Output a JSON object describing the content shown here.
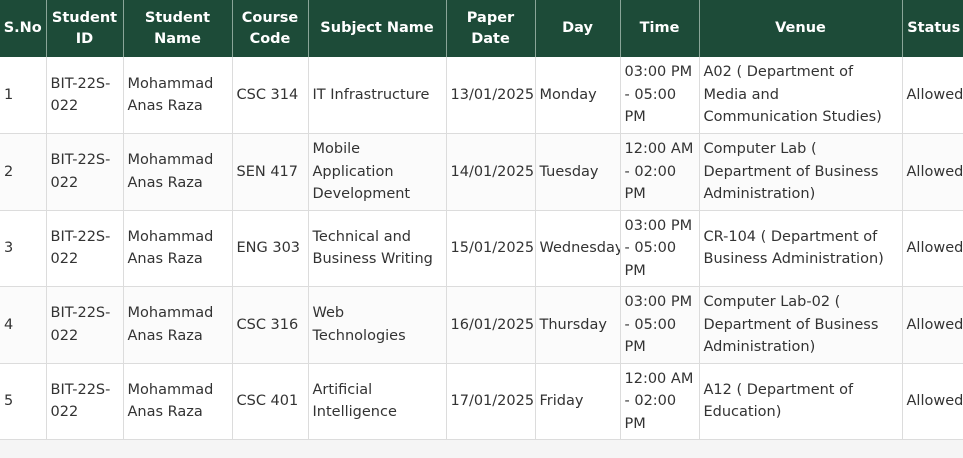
{
  "table": {
    "headers": [
      "S.No",
      "Student ID",
      "Student Name",
      "Course Code",
      "Subject Name",
      "Paper Date",
      "Day",
      "Time",
      "Venue",
      "Status"
    ],
    "rows": [
      {
        "sno": "1",
        "student_id": "BIT-22S-022",
        "student_name": "Mohammad Anas Raza",
        "course_code": "CSC 314",
        "subject_name": "IT Infrastructure",
        "paper_date": "13/01/2025",
        "day": "Monday",
        "time": "03:00 PM - 05:00 PM",
        "venue": "A02 ( Department of Media and Communication Studies)",
        "status": "Allowed"
      },
      {
        "sno": "2",
        "student_id": "BIT-22S-022",
        "student_name": "Mohammad Anas Raza",
        "course_code": "SEN 417",
        "subject_name": "Mobile Application Development",
        "paper_date": "14/01/2025",
        "day": "Tuesday",
        "time": "12:00 AM - 02:00 PM",
        "venue": "Computer Lab ( Department of Business Administration)",
        "status": "Allowed"
      },
      {
        "sno": "3",
        "student_id": "BIT-22S-022",
        "student_name": "Mohammad Anas Raza",
        "course_code": "ENG 303",
        "subject_name": "Technical and Business Writing",
        "paper_date": "15/01/2025",
        "day": "Wednesday",
        "time": "03:00 PM - 05:00 PM",
        "venue": "CR-104 ( Department of Business Administration)",
        "status": "Allowed"
      },
      {
        "sno": "4",
        "student_id": "BIT-22S-022",
        "student_name": "Mohammad Anas Raza",
        "course_code": "CSC 316",
        "subject_name": "Web Technologies",
        "paper_date": "16/01/2025",
        "day": "Thursday",
        "time": "03:00 PM - 05:00 PM",
        "venue": "Computer Lab-02 ( Department of Business Administration)",
        "status": "Allowed"
      },
      {
        "sno": "5",
        "student_id": "BIT-22S-022",
        "student_name": "Mohammad Anas Raza",
        "course_code": "CSC 401",
        "subject_name": "Artificial Intelligence",
        "paper_date": "17/01/2025",
        "day": "Friday",
        "time": "12:00 AM - 02:00 PM",
        "venue": "A12 ( Department of Education)",
        "status": "Allowed"
      }
    ]
  }
}
